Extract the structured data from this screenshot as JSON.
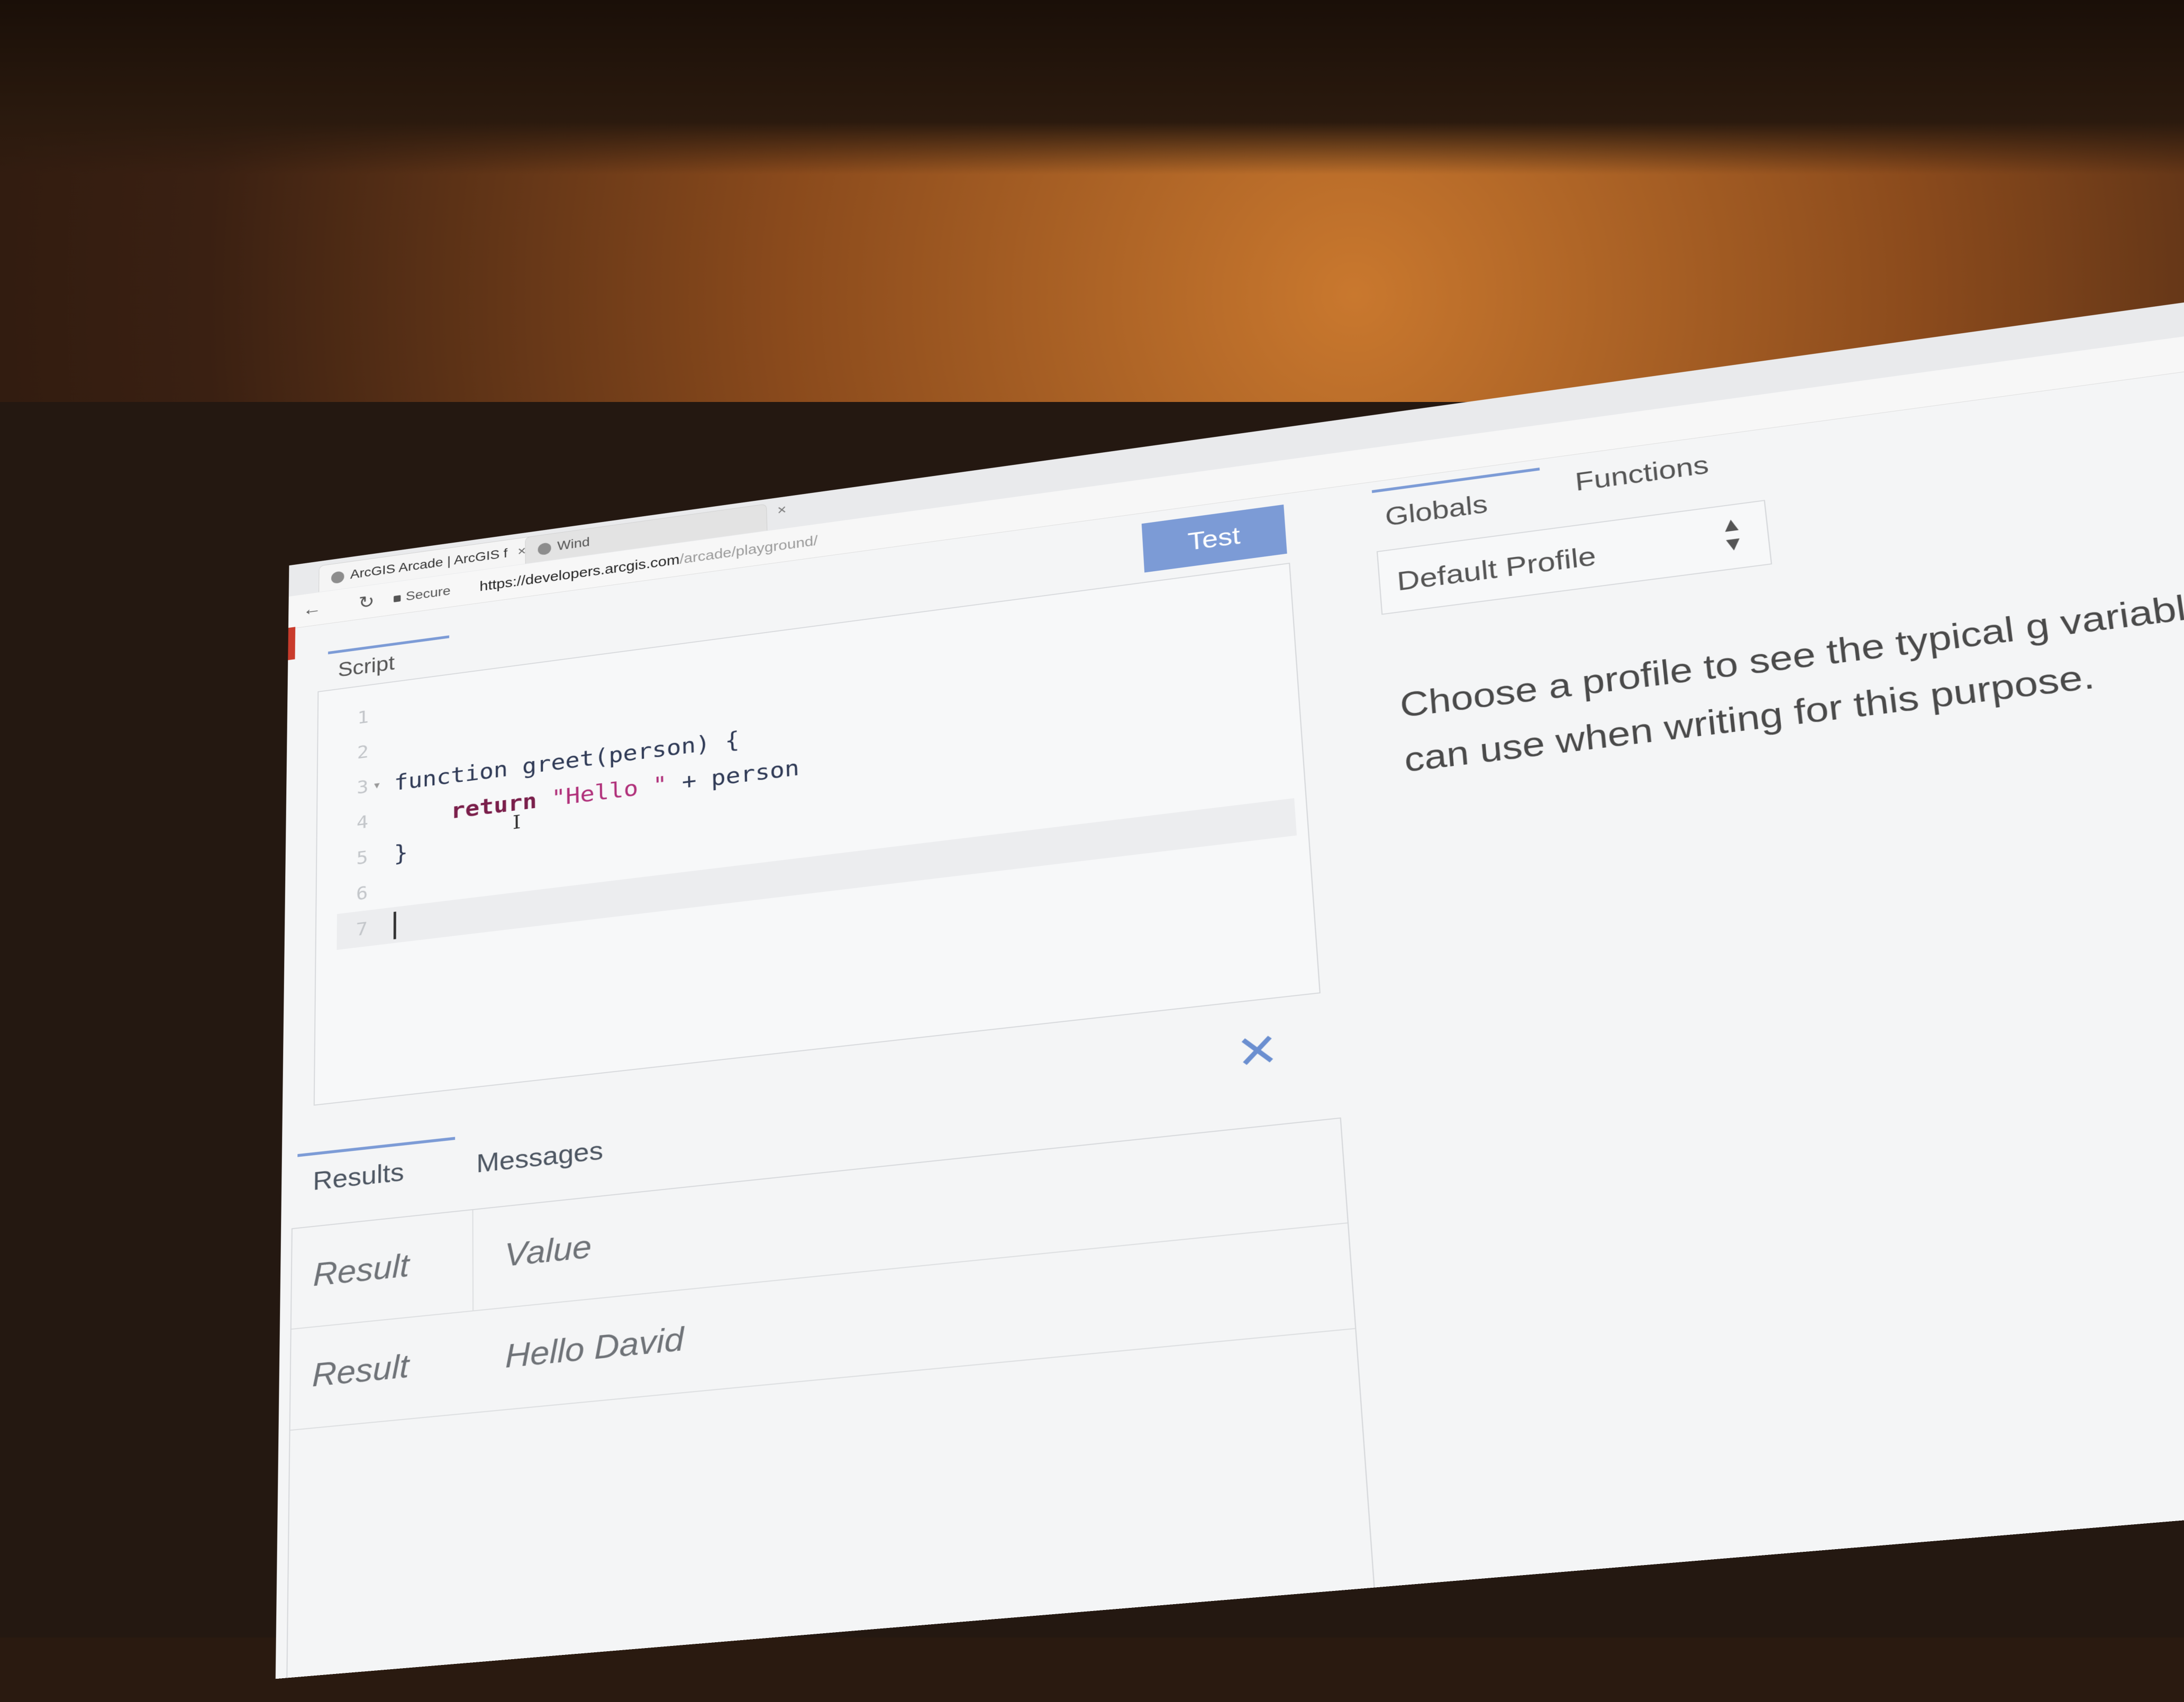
{
  "browser": {
    "tabs": [
      {
        "label": "ArcGIS Arcade | ArcGIS f"
      },
      {
        "label": "Wind"
      }
    ],
    "tab_close_glyph": "×",
    "secure_label": "Secure",
    "url_host": "https://developers.arcgis.com",
    "url_path": "/arcade/playground/"
  },
  "editor": {
    "test_button": "Test",
    "script_tab": "Script",
    "lines": [
      {
        "num": "1",
        "text": ""
      },
      {
        "num": "2",
        "text": ""
      },
      {
        "num": "3",
        "text": "function greet(person) {"
      },
      {
        "num": "4",
        "kw": "return",
        "str": "\"Hello \"",
        "rest": " + person"
      },
      {
        "num": "5",
        "text": "}"
      },
      {
        "num": "6",
        "text": ""
      },
      {
        "num": "7",
        "text": ""
      }
    ]
  },
  "results": {
    "tabs": [
      "Results",
      "Messages"
    ],
    "close_glyph": "✕",
    "header": {
      "col1": "Result",
      "col2": "Value"
    },
    "rows": [
      {
        "col1": "Result",
        "col2": "Hello David"
      }
    ]
  },
  "side_panel": {
    "tabs": [
      "Globals",
      "Functions"
    ],
    "profile_select": {
      "value": "Default Profile"
    },
    "description": "Choose a profile to see the typical g variables you can use when writing for this purpose."
  },
  "colors": {
    "accent": "#7c9bd6",
    "keyword": "#7a1f4b",
    "string": "#b0307a"
  }
}
